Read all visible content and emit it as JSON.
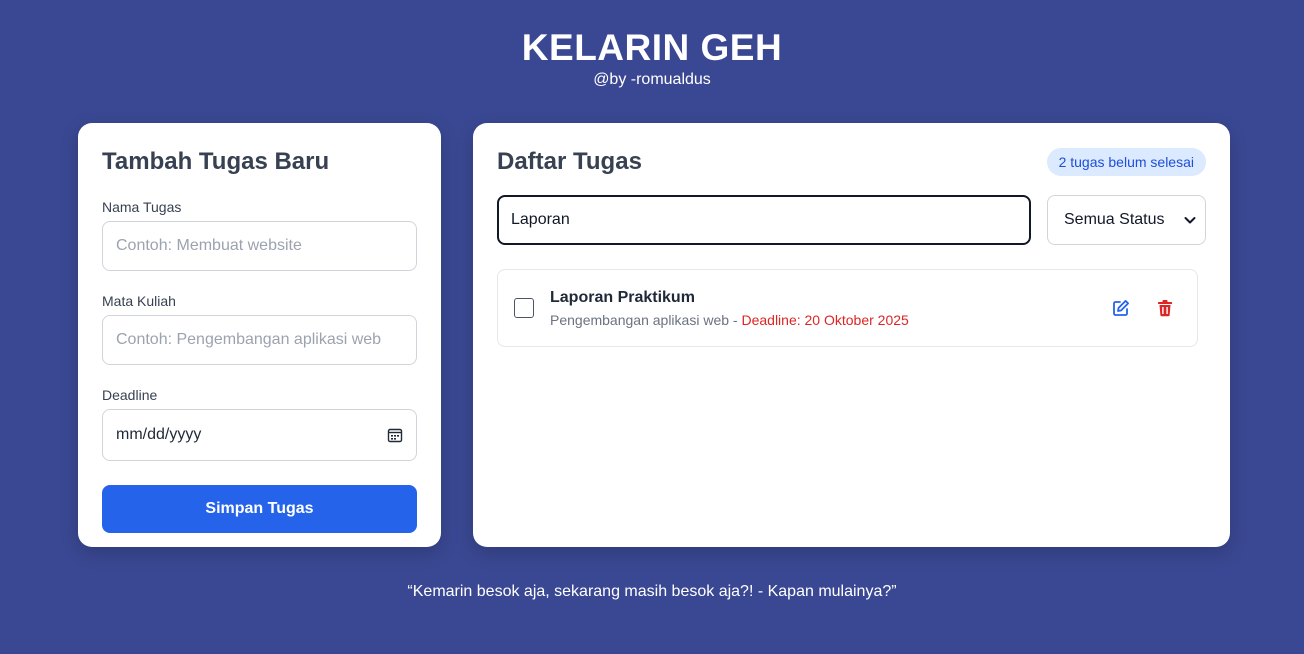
{
  "header": {
    "title": "KELARIN GEH",
    "subtitle": "@by -romualdus"
  },
  "form": {
    "title": "Tambah Tugas Baru",
    "name_label": "Nama Tugas",
    "name_placeholder": "Contoh: Membuat website",
    "course_label": "Mata Kuliah",
    "course_placeholder": "Contoh: Pengembangan aplikasi web",
    "deadline_label": "Deadline",
    "deadline_value": "mm/dd/yyyy",
    "deadline_icon": "calendar-icon",
    "save_label": "Simpan Tugas"
  },
  "list": {
    "title": "Daftar Tugas",
    "pending_badge": "2 tugas belum selesai",
    "search_value": "Laporan",
    "status_filter": "Semua Status",
    "tasks": [
      {
        "title": "Laporan Praktikum",
        "course": "Pengembangan aplikasi web",
        "separator": " - ",
        "deadline": "Deadline: 20 Oktober 2025",
        "completed": false,
        "edit_icon": "edit-icon",
        "delete_icon": "trash-icon"
      }
    ]
  },
  "footer": {
    "quote": "“Kemarin besok aja, sekarang masih besok aja?! - Kapan mulainya?”"
  },
  "colors": {
    "background": "#3a4893",
    "primary": "#2563eb",
    "danger": "#dc2626",
    "badge_bg": "#dbeafe",
    "badge_text": "#1d4ed8"
  }
}
